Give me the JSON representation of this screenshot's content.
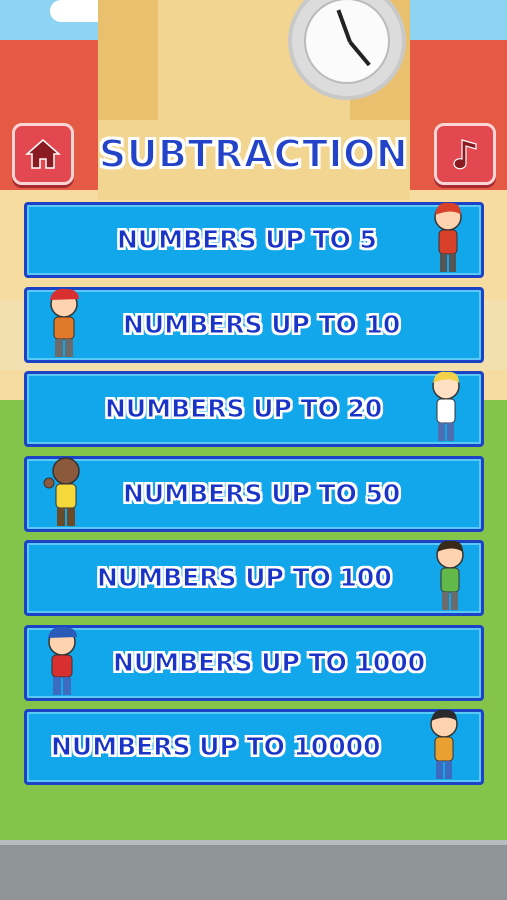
{
  "header": {
    "title": "SUBTRACTION",
    "home_icon": "home-icon",
    "music_icon": "music-note-icon"
  },
  "levels": [
    {
      "label": "NUMBERS UP TO 5"
    },
    {
      "label": "NUMBERS UP TO 10"
    },
    {
      "label": "NUMBERS UP TO 20"
    },
    {
      "label": "NUMBERS UP TO 50"
    },
    {
      "label": "NUMBERS UP TO 100"
    },
    {
      "label": "NUMBERS UP TO 1000"
    },
    {
      "label": "NUMBERS UP TO 10000"
    }
  ],
  "colors": {
    "button_fill": "#12a7ea",
    "button_border": "#1c43c6",
    "label_text": "#1b34c8",
    "icon_button": "#e3474f",
    "grass": "#84c44a"
  }
}
